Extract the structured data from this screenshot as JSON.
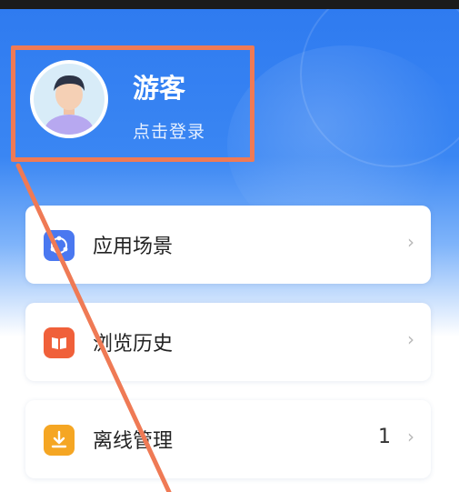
{
  "profile": {
    "username": "游客",
    "login_prompt": "点击登录"
  },
  "menu": [
    {
      "label": "应用场景",
      "icon": "scene-icon",
      "color": "#4a78f0"
    },
    {
      "label": "浏览历史",
      "icon": "book-icon",
      "color": "#f0603a"
    },
    {
      "label": "离线管理",
      "icon": "download-icon",
      "color": "#f5a623",
      "count": "1"
    }
  ],
  "colors": {
    "hero": "#3a86f3",
    "highlight": "#ef7a55"
  }
}
